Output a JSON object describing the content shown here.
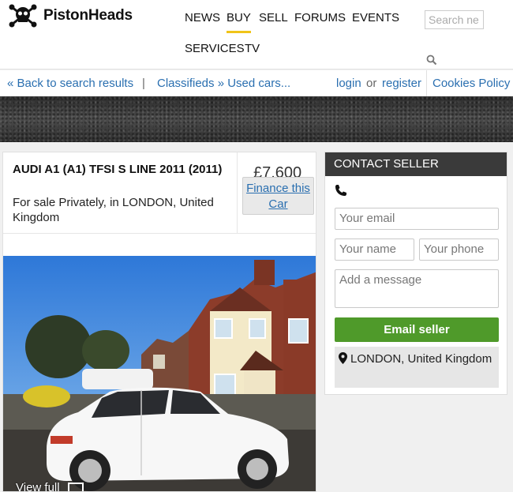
{
  "header": {
    "logo_text": "PistonHeads",
    "nav": [
      "NEWS",
      "BUY",
      "SELL",
      "FORUMS",
      "EVENTS",
      "SERVICES",
      "TV"
    ],
    "search_placeholder": "Search ne"
  },
  "subnav": {
    "back": "« Back to search results",
    "sep": "|",
    "crumb": "Classifieds » Used cars...",
    "login": "login",
    "or": "or",
    "register": "register",
    "cookies": "Cookies Policy"
  },
  "listing": {
    "title": "AUDI A1 (A1) TFSI S LINE 2011 (2011)",
    "location_line": "For sale Privately, in LONDON, United Kingdom",
    "price": "£7,600",
    "finance_label": "Finance this Car",
    "view_full": "View full"
  },
  "contact": {
    "heading": "CONTACT SELLER",
    "email_placeholder": "Your email",
    "name_placeholder": "Your name",
    "phone_placeholder": "Your phone",
    "message_placeholder": "Add a message",
    "email_button": "Email seller",
    "location": "LONDON, United Kingdom"
  },
  "colors": {
    "accent_underline": "#f0c419",
    "link": "#2a6fb0",
    "button_green": "#4f9a2a",
    "contact_header": "#3a3a3a"
  }
}
